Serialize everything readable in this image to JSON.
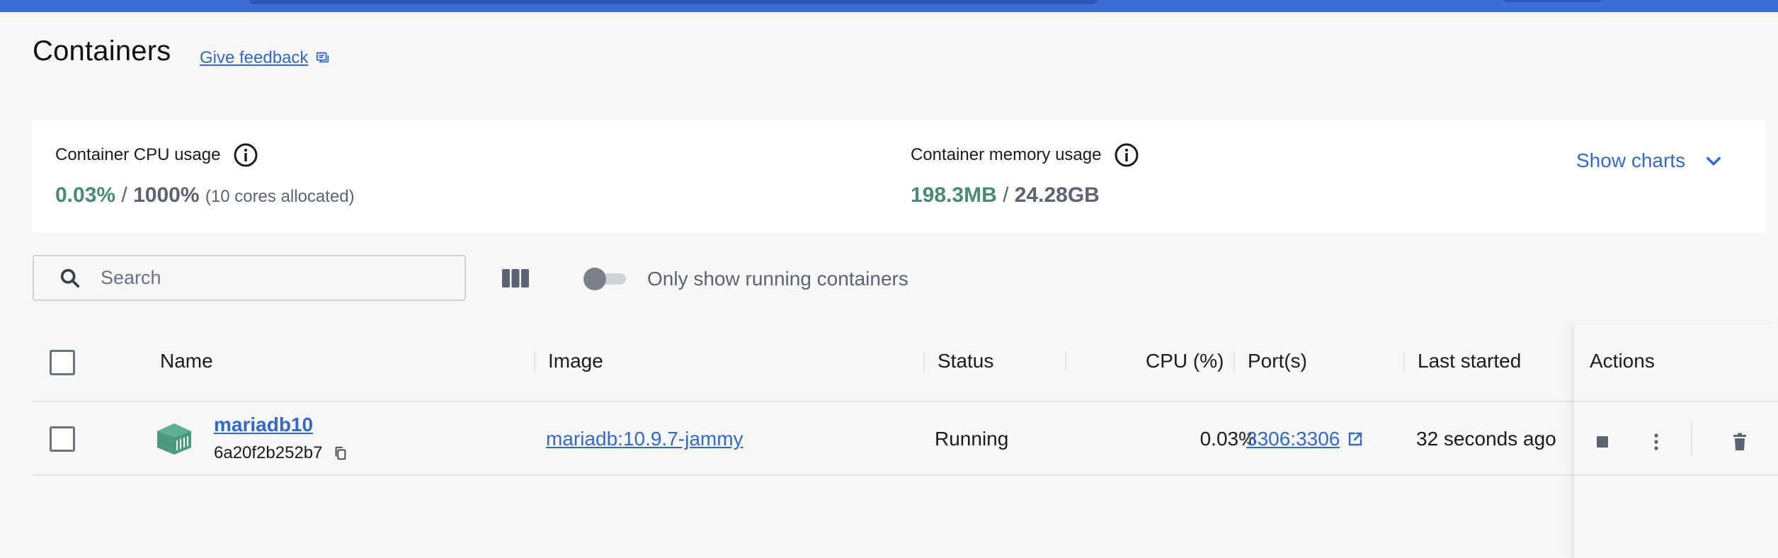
{
  "header": {
    "title": "Containers",
    "feedback_label": "Give feedback"
  },
  "stats": {
    "cpu": {
      "label": "Container CPU usage",
      "used": "0.03%",
      "separator": " / ",
      "total": "1000%",
      "note": "(10 cores allocated)"
    },
    "memory": {
      "label": "Container memory usage",
      "used": "198.3MB",
      "separator": " / ",
      "total": "24.28GB"
    },
    "show_charts_label": "Show charts"
  },
  "toolbar": {
    "search_placeholder": "Search",
    "running_toggle_label": "Only show running containers",
    "running_toggle_on": false
  },
  "table": {
    "columns": {
      "name": "Name",
      "image": "Image",
      "status": "Status",
      "cpu": "CPU (%)",
      "ports": "Port(s)",
      "last_started": "Last started",
      "actions": "Actions"
    },
    "rows": [
      {
        "name": "mariadb10",
        "id": "6a20f2b252b7",
        "image": "mariadb:10.9.7-jammy",
        "status": "Running",
        "cpu": "0.03%",
        "ports": "3306:3306",
        "last_started": "32 seconds ago",
        "selected": false
      }
    ]
  },
  "colors": {
    "topbar": "#3a6fd8",
    "link": "#3469c9",
    "stat_highlight": "#4b8a72",
    "container_icon": "#4b9a80"
  },
  "icons": {
    "feedback": "feedback-icon",
    "info": "info-icon",
    "chevron": "chevron-down-icon",
    "search": "search-icon",
    "columns": "columns-icon",
    "container": "container-icon",
    "copy": "copy-icon",
    "external_link": "external-link-icon",
    "stop": "stop-icon",
    "more": "more-vertical-icon",
    "delete": "trash-icon"
  }
}
